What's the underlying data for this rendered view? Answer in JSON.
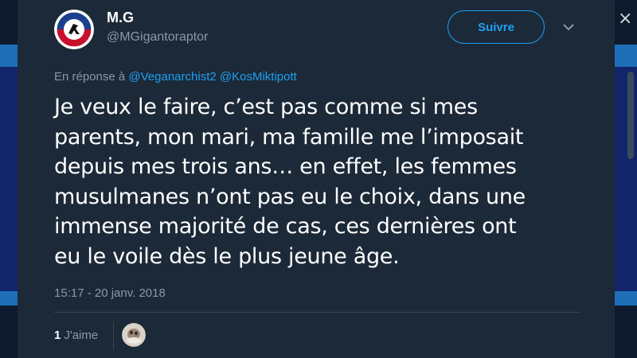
{
  "tweet": {
    "display_name": "M.G",
    "handle": "@MGigantoraptor",
    "follow_label": "Suivre",
    "reply_prefix": "En réponse à",
    "reply_mentions": [
      "@Veganarchist2",
      "@KosMiktipott"
    ],
    "text_lines": [
      "Je veux le faire, c’est pas comme si mes",
      "parents, mon mari, ma famille me l’imposait",
      "depuis mes trois ans… en effet, les femmes",
      "musulmanes n’ont pas eu le choix, dans une",
      "immense majorité de cas, ces dernières ont",
      "eu le voile dès le plus jeune âge."
    ],
    "timestamp": "15:17 - 20 janv. 2018",
    "like_count": "1",
    "like_label": "J'aime"
  },
  "icons": {
    "close": "close-icon",
    "caret": "chevron-down-icon"
  },
  "colors": {
    "modal_bg": "#1c2938",
    "accent": "#1da1f2",
    "secondary_text": "#8899a6"
  }
}
